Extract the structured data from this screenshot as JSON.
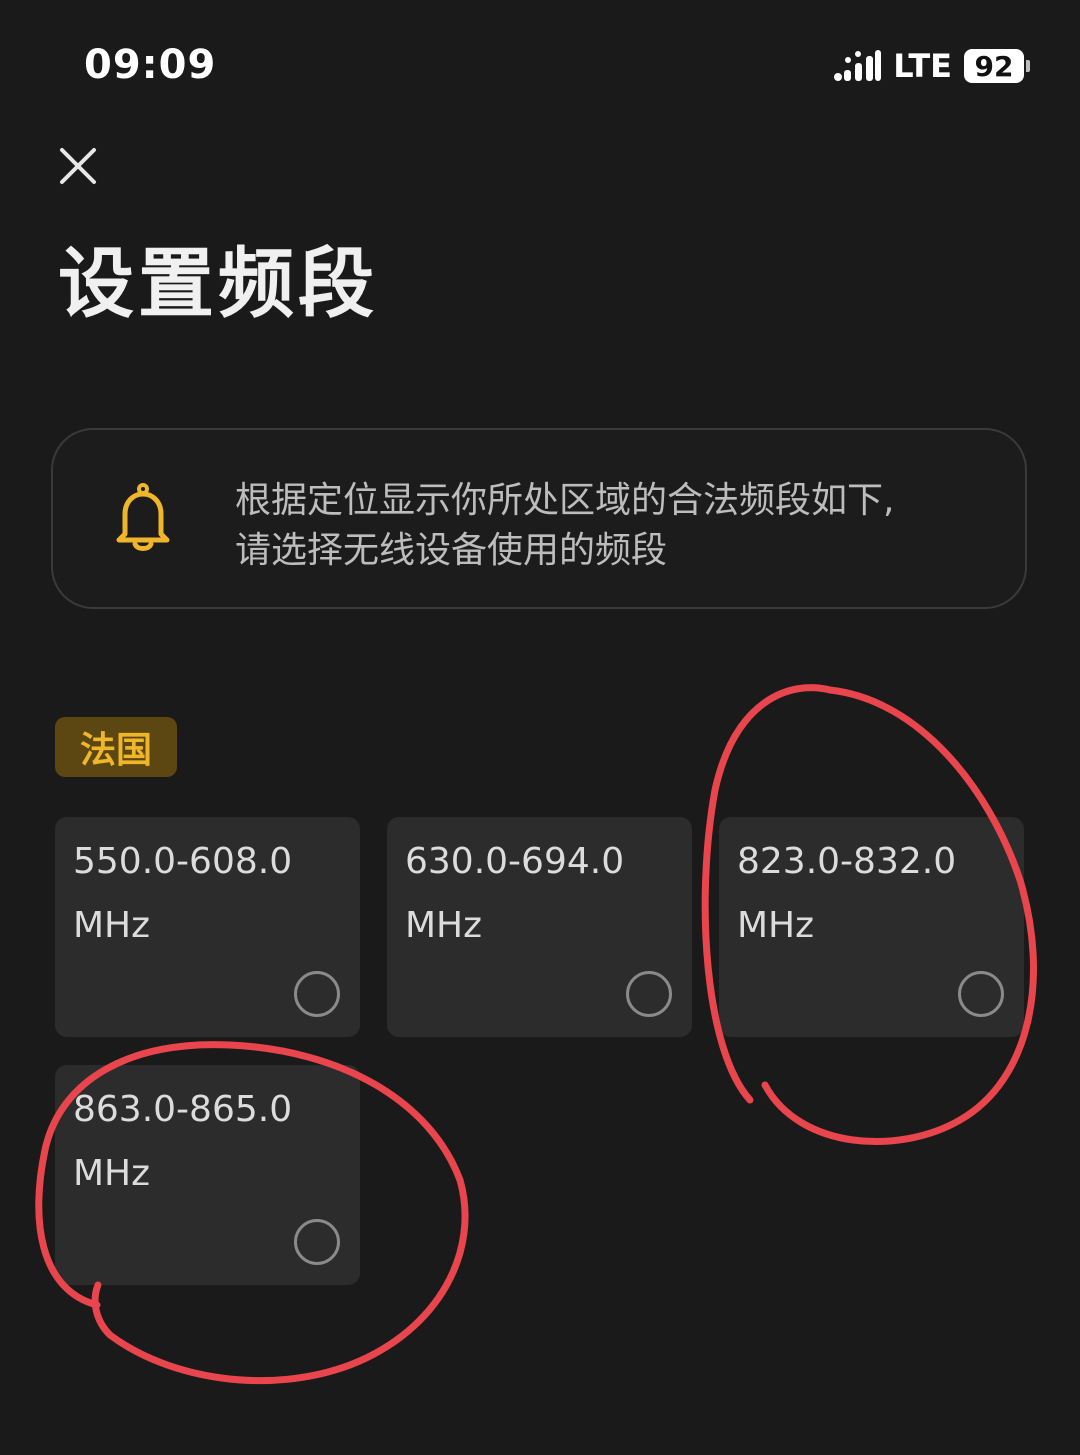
{
  "status_bar": {
    "time": "09:09",
    "network": "LTE",
    "battery": "92"
  },
  "header": {
    "title": "设置频段"
  },
  "notice": {
    "line1": "根据定位显示你所处区域的合法频段如下,",
    "line2": "请选择无线设备使用的频段"
  },
  "region": {
    "label": "法国"
  },
  "bands": [
    {
      "range": "550.0-608.0",
      "unit": "MHz",
      "selected": false
    },
    {
      "range": "630.0-694.0",
      "unit": "MHz",
      "selected": false
    },
    {
      "range": "823.0-832.0",
      "unit": "MHz",
      "selected": false
    },
    {
      "range": "863.0-865.0",
      "unit": "MHz",
      "selected": false
    }
  ],
  "colors": {
    "background": "#1a1a1a",
    "card": "#2c2c2c",
    "accent": "#f0b62a",
    "annotation": "#e8454d"
  },
  "icons": {
    "close": "close-icon",
    "notice": "bell-icon",
    "signal": "signal-icon"
  }
}
